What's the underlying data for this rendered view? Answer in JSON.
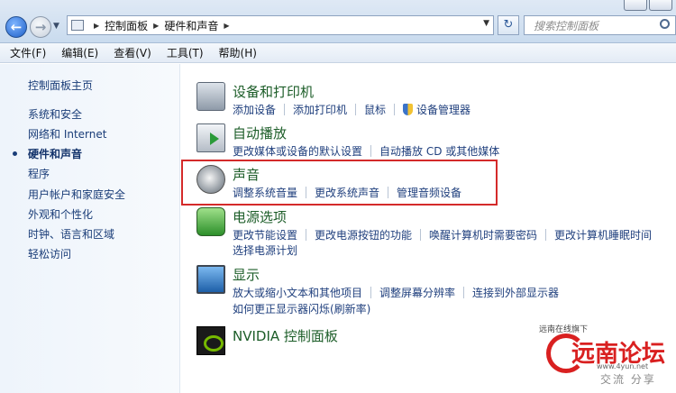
{
  "window": {
    "buttons": [
      "minimize",
      "maximize"
    ]
  },
  "address": {
    "crumbs": [
      "控制面板",
      "硬件和声音"
    ],
    "search_placeholder": "搜索控制面板"
  },
  "menu": [
    "文件(F)",
    "编辑(E)",
    "查看(V)",
    "工具(T)",
    "帮助(H)"
  ],
  "sidebar": {
    "items": [
      {
        "label": "控制面板主页",
        "active": false
      },
      {
        "label": "系统和安全",
        "active": false
      },
      {
        "label": "网络和 Internet",
        "active": false
      },
      {
        "label": "硬件和声音",
        "active": true
      },
      {
        "label": "程序",
        "active": false
      },
      {
        "label": "用户帐户和家庭安全",
        "active": false
      },
      {
        "label": "外观和个性化",
        "active": false
      },
      {
        "label": "时钟、语言和区域",
        "active": false
      },
      {
        "label": "轻松访问",
        "active": false
      }
    ]
  },
  "sections": [
    {
      "icon": "printer-icon",
      "title": "设备和打印机",
      "links": [
        "添加设备",
        "添加打印机",
        "鼠标",
        "设备管理器"
      ],
      "links2": []
    },
    {
      "icon": "autoplay-icon",
      "title": "自动播放",
      "links": [
        "更改媒体或设备的默认设置",
        "自动播放 CD 或其他媒体"
      ],
      "links2": []
    },
    {
      "icon": "speaker-icon",
      "title": "声音",
      "links": [
        "调整系统音量",
        "更改系统声音",
        "管理音频设备"
      ],
      "links2": []
    },
    {
      "icon": "power-icon",
      "title": "电源选项",
      "links": [
        "更改节能设置",
        "更改电源按钮的功能",
        "唤醒计算机时需要密码",
        "更改计算机睡眠时间"
      ],
      "links2": [
        "选择电源计划"
      ]
    },
    {
      "icon": "display-icon",
      "title": "显示",
      "links": [
        "放大或缩小文本和其他项目",
        "调整屏幕分辨率",
        "连接到外部显示器"
      ],
      "links2": [
        "如何更正显示器闪烁(刷新率)"
      ]
    },
    {
      "icon": "nvidia-icon",
      "title": "NVIDIA 控制面板",
      "links": [],
      "links2": []
    }
  ],
  "watermark": {
    "top": "远南在线旗下",
    "title": "远南论坛",
    "url": "www.4yun.net",
    "sub": "交流 分享"
  },
  "colors": {
    "highlight_border": "#d42a2a",
    "title_green": "#1c5d28",
    "link_blue": "#1f3f7d"
  }
}
